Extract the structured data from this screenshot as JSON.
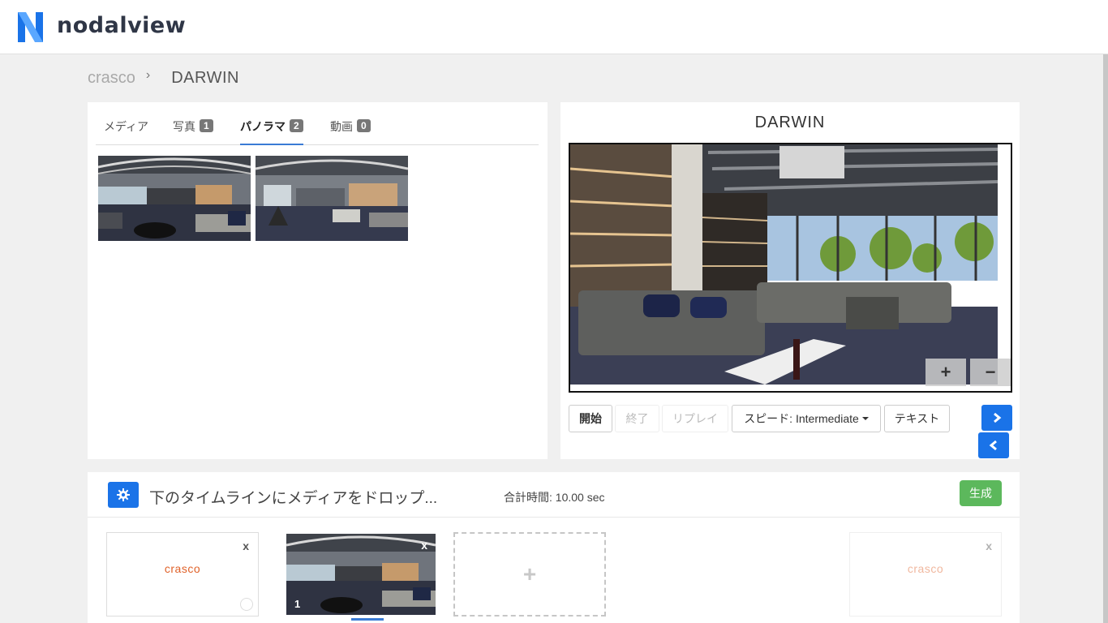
{
  "app": {
    "name": "nodalview",
    "logo_icon": "nodalview-n-logo"
  },
  "breadcrumb": {
    "root": "crasco",
    "separator": "›",
    "current": "DARWIN"
  },
  "media_tabs": [
    {
      "label": "メディア",
      "count": null,
      "active": false
    },
    {
      "label": "写真",
      "count": "1",
      "active": false
    },
    {
      "label": "パノラマ",
      "count": "2",
      "active": true
    },
    {
      "label": "動画",
      "count": "0",
      "active": false
    }
  ],
  "preview": {
    "title": "DARWIN",
    "zoom_in": "+",
    "zoom_out": "−",
    "controls": {
      "start": "開始",
      "end": "終了",
      "replay": "リプレイ",
      "speed": "スピード: Intermediate",
      "text": "テキスト"
    },
    "next_icon": "chevron-right-icon",
    "prev_icon": "chevron-left-icon"
  },
  "timeline": {
    "settings_icon": "gear-icon",
    "drop_hint": "下のタイムラインにメディアをドロップ...",
    "total_time": "合計時間: 10.00 sec",
    "generate": "生成",
    "slides": [
      {
        "type": "logo",
        "text": "crasco",
        "close": "x"
      },
      {
        "type": "panorama",
        "number": "1",
        "close": "x"
      },
      {
        "type": "add",
        "text": "+"
      },
      {
        "type": "logo",
        "text": "crasco",
        "close": "x"
      }
    ]
  },
  "colors": {
    "accent_blue": "#1a73e8",
    "success_green": "#5cb85c",
    "logo_orange": "#e0622a"
  }
}
